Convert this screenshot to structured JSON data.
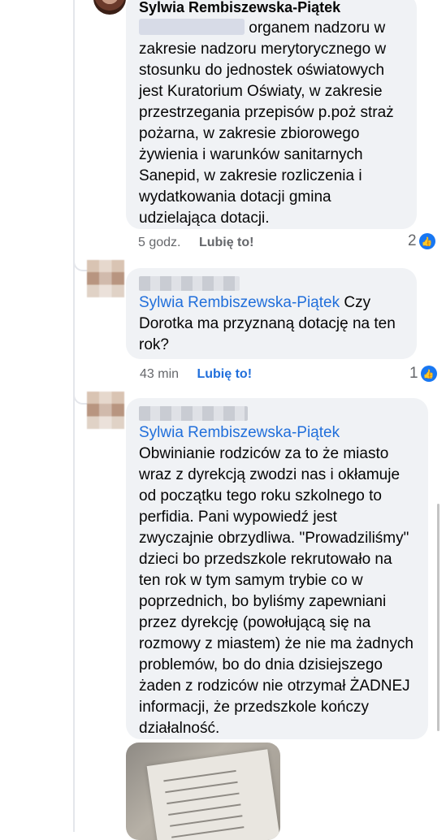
{
  "comments": [
    {
      "author": "Sylwia Rembiszewska-Piątek",
      "text_after_redaction": "organem nadzoru w zakresie nadzoru merytorycznego w stosunku do jednostek oświatowych jest Kuratorium Oświaty, w zakresie przestrzegania przepisów p.poż straż pożarna, w zakresie zbiorowego żywienia i warunków sanitarnych Sanepid, w zakresie rozliczenia i wydatkowania dotacji gmina udzielająca dotacji.",
      "time": "5 godz.",
      "like_label": "Lubię to!",
      "reaction_count": "2"
    },
    {
      "mention": "Sylwia Rembiszewska-Piątek",
      "text": "Czy Dorotka ma przyznaną dotację na ten rok?",
      "time": "43 min",
      "like_label": "Lubię to!",
      "reaction_count": "1"
    },
    {
      "mention": "Sylwia Rembiszewska-Piątek",
      "text": "Obwinianie rodziców za to że miasto wraz z dyrekcją zwodzi nas i okłamuje od początku tego roku szkolnego to perfidia. Pani wypowiedź jest zwyczajnie obrzydliwa. \"Prowadziliśmy\" dzieci bo przedszkole rekrutowało na ten rok w tym samym trybie co w poprzednich, bo byliśmy zapewniani przez dyrekcję (powołującą się na rozmowy z miastem) że nie ma żadnych problemów, bo do dnia dzisiejszego żaden z rodziców nie otrzymał ŻADNEJ informacji, że przedszkole kończy działalność."
    }
  ],
  "icons": {
    "like": "thumbs-up-icon"
  },
  "colors": {
    "bubble": "#f0f2f5",
    "mention": "#216fdb",
    "like_badge": "#1877f2"
  }
}
